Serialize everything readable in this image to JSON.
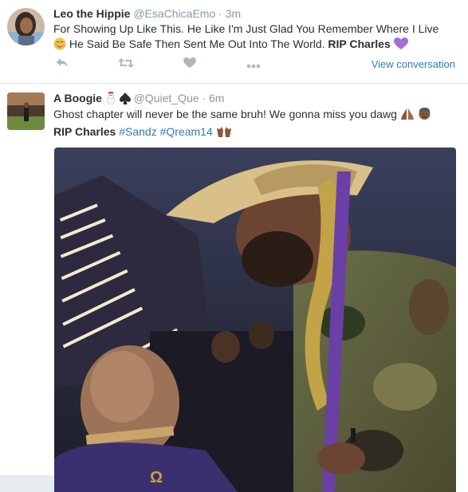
{
  "tweets": [
    {
      "name": "Leo the Hippie",
      "handle": "@EsaChicaEmo",
      "time": "3m",
      "text_part1": "For Showing Up Like This. He Like I'm Just Glad You Remember Where I Live",
      "text_part2": "He Said Be Safe Then Sent Me Out Into The World.",
      "text_bold": "RIP Charles",
      "emojis": [
        "blushing-face-emoji",
        "purple-heart-emoji"
      ],
      "view_conversation": "View conversation",
      "actions": [
        "reply-icon",
        "retweet-icon",
        "like-icon",
        "more-icon"
      ]
    },
    {
      "name": "A Boogie",
      "handle": "@Quiet_Que",
      "time": "6m",
      "text_line1": "Ghost chapter will never be the same bruh! We gonna miss you dawg",
      "text_bold": "RIP Charles",
      "hashtags": [
        "#Sandz",
        "#Qream14"
      ],
      "emojis": [
        "snowman-emoji",
        "spade-emoji",
        "folded-hands-emoji",
        "man-emoji",
        "raised-hands-emoji"
      ]
    }
  ],
  "colors": {
    "link": "#2b7bb9",
    "meta": "#8899a6",
    "icon": "#aab8c2",
    "text": "#292f33",
    "accent_purple": "#a66fd6"
  }
}
